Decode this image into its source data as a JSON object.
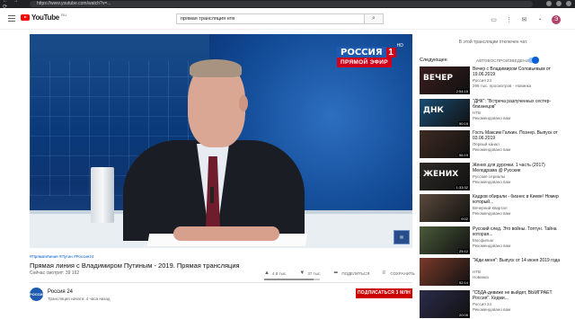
{
  "browser": {
    "url": "https://www.youtube.com/watch?v=..."
  },
  "header": {
    "logo_text": "YouTube",
    "logo_region": "RU",
    "search_value": "прямая трансляция нтв",
    "avatar_letter": "Э"
  },
  "player": {
    "channel_name": "РОССИЯ",
    "channel_number": "1",
    "hd_label": "HD",
    "live_label": "ПРЯМОЙ ЭФИР"
  },
  "video": {
    "hashtags": "#ПрямаяЛиния #Путин #Россия24",
    "title": "Прямая линия с Владимиром Путиным - 2019. Прямая трансляция",
    "views": "Сейчас смотрят: 39 162",
    "likes": "4,8 тыс.",
    "dislikes": "37 тыс.",
    "share_label": "ПОДЕЛИТЬСЯ",
    "save_label": "СОХРАНИТЬ",
    "like_ratio": 0.88
  },
  "owner": {
    "avatar_text": "РОССИЯ 24",
    "name": "Россия 24",
    "subs": "Трансляция начата: 4 часа назад",
    "subscribe_label": "ПОДПИСАТЬСЯ 3 МЛН"
  },
  "sidebar": {
    "chat_note": "В этой трансляции отключен чат.",
    "up_next": "Следующее",
    "autoplay": "АВТОВОСПРОИЗВЕДЕНИЕ",
    "items": [
      {
        "title": "Вечер с Владимиром Соловьевым от 19.06.2019",
        "channel": "Россия 24",
        "meta": "296 тыс. просмотров · Новинка",
        "duration": "2:54:15",
        "thumb_color": "#3a1d1d",
        "thumb_text": "ВЕЧЕР"
      },
      {
        "title": "\"ДНК\": \"Встреча разлученных сестер-близнецов\"",
        "channel": "НТВ",
        "meta": "Рекомендовано вам",
        "duration": "50:19",
        "thumb_color": "#184d73",
        "thumb_text": "ДНК"
      },
      {
        "title": "Гость Максим Галкин. Познер. Выпуск от 03.06.2019",
        "channel": "Первый канал",
        "meta": "Рекомендовано вам",
        "duration": "56:19",
        "thumb_color": "#3e2b24",
        "thumb_text": ""
      },
      {
        "title": "Жених для дурочки. 1 часть (2017) Мелодрама @ Русские",
        "channel": "Русские сериалы",
        "meta": "Рекомендовано вам",
        "duration": "1:33:32",
        "thumb_color": "#2d2a26",
        "thumb_text": "ЖЕНИХ"
      },
      {
        "title": "Кадров обирали - бизнес в Киеве! Номер который...",
        "channel": "Вечерний Квартал",
        "meta": "Рекомендовано вам",
        "duration": "9:02",
        "thumb_color": "#5a4a3c",
        "thumb_text": ""
      },
      {
        "title": "Русский след. Это войны. Топтун. Тайна которая...",
        "channel": "Мосфильм",
        "meta": "Рекомендовано вам",
        "duration": "25:12",
        "thumb_color": "#4a5a3a",
        "thumb_text": ""
      },
      {
        "title": "\"Жди меня\": Выпуск от 14 июня 2019 года",
        "channel": "НТВ",
        "meta": "Новинка",
        "duration": "52:14",
        "thumb_color": "#7a3a2a",
        "thumb_text": ""
      },
      {
        "title": "\"СБДА-девиже не выйдет, ВЫИГРАЕТ Россия\". Кедми...",
        "channel": "Россия 24",
        "meta": "Рекомендовано вам",
        "duration": "20:05",
        "thumb_color": "#2b2b4a",
        "thumb_text": ""
      }
    ]
  }
}
